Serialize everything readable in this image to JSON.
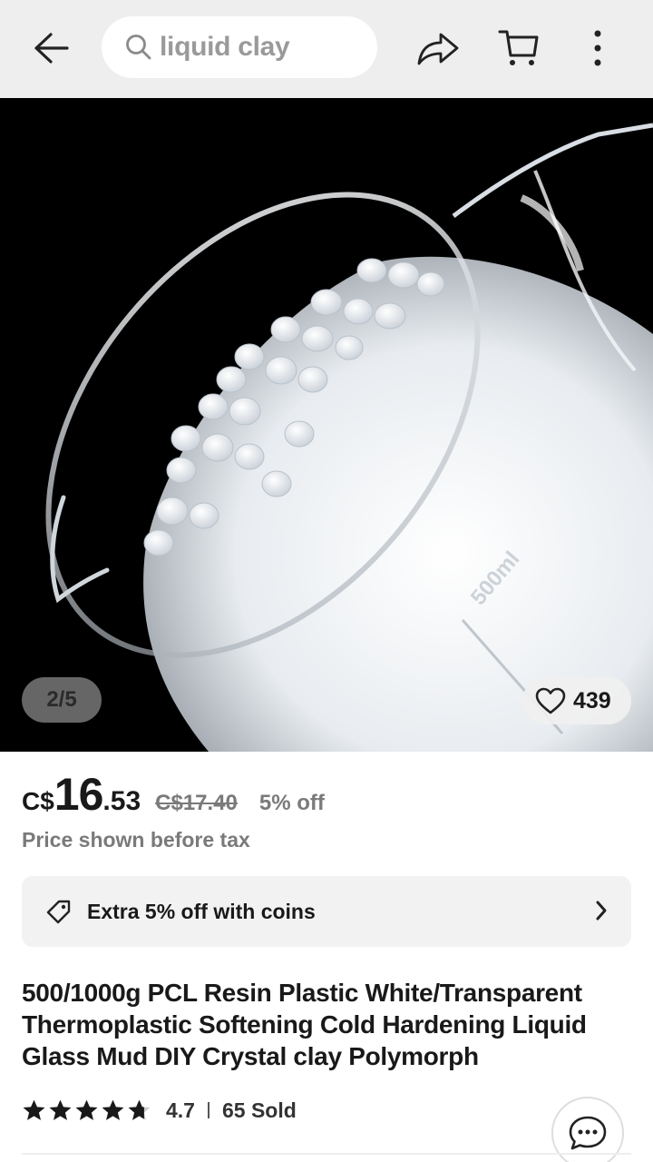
{
  "header": {
    "back_icon": "arrow-left-icon",
    "search_icon": "search-icon",
    "search_query": "liquid clay",
    "share_icon": "share-arrow-icon",
    "cart_icon": "cart-icon",
    "more_icon": "vertical-dots-icon"
  },
  "gallery": {
    "indicator": "2/5",
    "wishlist_icon": "heart-icon",
    "wishlist_count": "439",
    "photo_label": "500ml"
  },
  "price": {
    "currency": "C$",
    "integer": "16",
    "decimal": ".53",
    "original": "C$17.40",
    "discount": "5% off",
    "tax_note": "Price shown before tax"
  },
  "coins": {
    "icon": "tag-icon",
    "label": "Extra 5% off with coins",
    "chevron_icon": "chevron-right-icon"
  },
  "product": {
    "title": "500/1000g PCL Resin Plastic White/Transparent Thermoplastic Softening Cold Hardening Liquid Glass Mud DIY Crystal clay Polymorph",
    "rating": "4.7",
    "rating_stars": 4.7,
    "sold": "65 Sold",
    "chat_icon": "chat-bubble-icon"
  },
  "colors": {
    "topbar_bg": "#eeeeee",
    "text_primary": "#191919",
    "text_secondary": "#7a7a7a",
    "coins_bg": "#f2f2f2"
  }
}
